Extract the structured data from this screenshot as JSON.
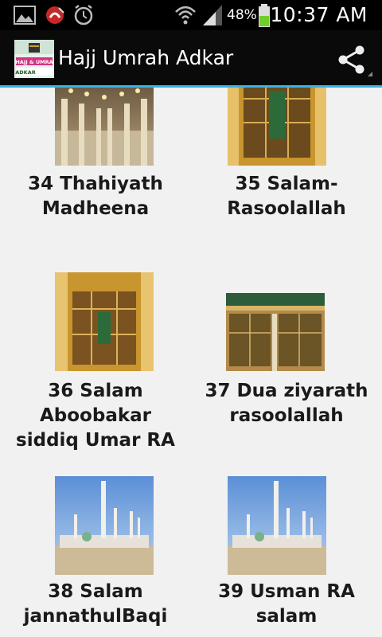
{
  "status_bar": {
    "icons": [
      "gallery-icon",
      "missed-call-icon",
      "alarm-icon",
      "wifi-icon",
      "signal-icon",
      "battery-icon"
    ],
    "battery_percent": "48%",
    "time": "10:37 AM"
  },
  "action_bar": {
    "title": "Hajj Umrah Adkar",
    "logo_text_line1": "HAJJ & UMRA",
    "logo_text_line2": "ADKAR",
    "share_icon": "share-icon",
    "accent_color": "#33b5e5"
  },
  "items": [
    {
      "label": "34 Thahiyath\nMadheena",
      "image": "mosque-interior-arches"
    },
    {
      "label": "35 Salam-\nRasoolallah",
      "image": "golden-grille"
    },
    {
      "label": "36 Salam\nAboobakar\nsiddiq Umar RA",
      "image": "golden-grille"
    },
    {
      "label": "37 Dua ziyarath\nrasoolallah",
      "image": "green-golden-grille"
    },
    {
      "label": "38 Salam\njannathulBaqi",
      "image": "mosque-minarets"
    },
    {
      "label": "39 Usman RA\nsalam",
      "image": "mosque-minarets"
    }
  ]
}
